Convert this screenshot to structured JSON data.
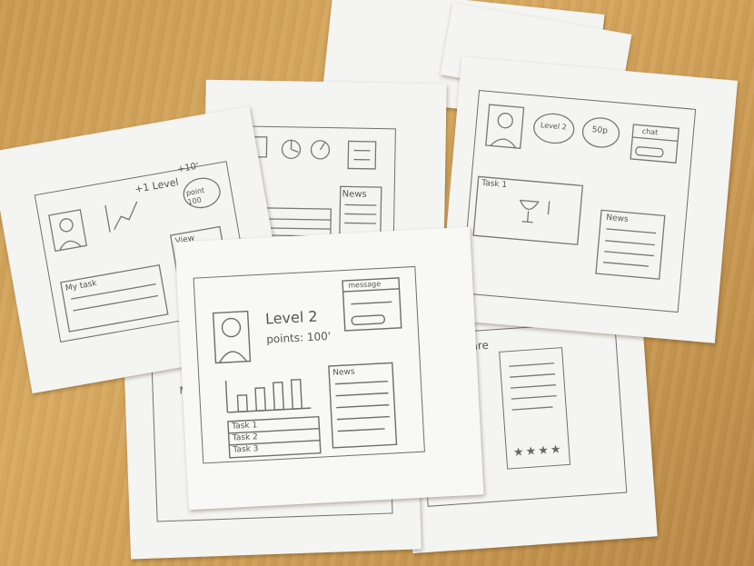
{
  "sketch_a": {
    "level_text": "+1 Level",
    "points_badge": "point 100",
    "corner_note": "+10'",
    "task_label": "My task",
    "news_label": "View"
  },
  "sketch_b": {
    "news_label": "News"
  },
  "sketch_c": {
    "level_badge": "Level 2",
    "points_badge": "50p",
    "chat_label": "chat",
    "task_label": "Task 1",
    "news_label": "News"
  },
  "sketch_d": {
    "level_title": "Level 2",
    "points_line": "points: 100'",
    "message_label": "message",
    "news_label": "News",
    "tasks": [
      {
        "name": "Task 1"
      },
      {
        "name": "Task 2"
      },
      {
        "name": "Task 3"
      }
    ]
  },
  "sketch_e": {
    "news_label": "ware",
    "rating_stars": "★★★★"
  },
  "sketch_f": {
    "task_label": "My"
  }
}
